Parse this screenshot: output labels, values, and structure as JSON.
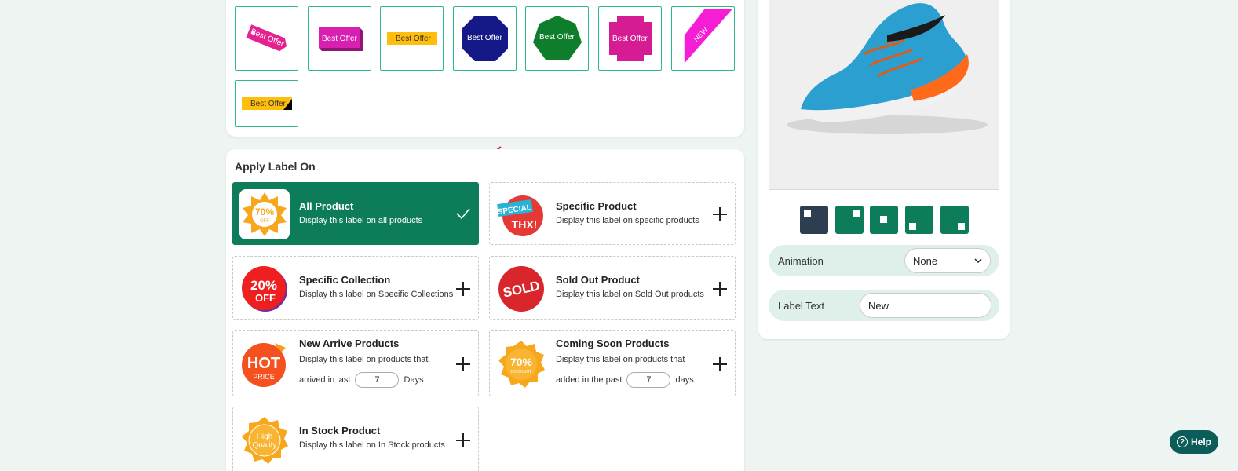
{
  "label_styles": [
    {
      "name": "tag",
      "text": "Best Offer"
    },
    {
      "name": "ribbon-3d",
      "text": "Best Offer"
    },
    {
      "name": "flat-yellow",
      "text": "Best Offer"
    },
    {
      "name": "octagon-navy",
      "text": "Best Offer"
    },
    {
      "name": "heptagon-green",
      "text": "Best Offer"
    },
    {
      "name": "cross-pink",
      "text": "Best Offer"
    },
    {
      "name": "corner-ribbon",
      "text": "NEW"
    },
    {
      "name": "yellow-black-corner",
      "text": "Best Offer"
    }
  ],
  "apply": {
    "section_title": "Apply Label On",
    "options": [
      {
        "id": "all",
        "title": "All Product",
        "desc": "Display this label on all products",
        "icon_text": "70%",
        "icon_sub": "OFF",
        "selected": true
      },
      {
        "id": "specific-product",
        "title": "Specific Product",
        "desc": "Display this label on specific products",
        "icon_text": "SPECIAL",
        "icon_sub": "THX!"
      },
      {
        "id": "specific-collection",
        "title": "Specific Collection",
        "desc": "Display this label on Specific Collections",
        "icon_text": "20%",
        "icon_sub": "OFF"
      },
      {
        "id": "sold-out",
        "title": "Sold Out Product",
        "desc": "Display this label on Sold Out products",
        "icon_text": "SOLD"
      },
      {
        "id": "new-arrive",
        "title": "New Arrive Products",
        "desc": "Display this label on products that",
        "desc2_pre": "arrived in last",
        "days_value": "7",
        "desc2_post": "Days",
        "icon_text": "HOT",
        "icon_sub": "PRICE"
      },
      {
        "id": "coming-soon",
        "title": "Coming Soon Products",
        "desc": "Display this label on products that",
        "desc2_pre": "added in the past",
        "days_value": "7",
        "desc2_post": "days",
        "icon_text": "70%",
        "icon_sub": "DISCOUNT"
      },
      {
        "id": "in-stock",
        "title": "In Stock Product",
        "desc": "Display this label on In Stock products",
        "icon_text": "High",
        "icon_sub": "Quality"
      }
    ]
  },
  "preview": {
    "animation_label": "Animation",
    "animation_value": "None",
    "label_text_label": "Label Text",
    "label_text_value": "New"
  },
  "help_label": "Help",
  "colors": {
    "accent": "#0d7c5b",
    "active_position": "#2c3e50",
    "tile_border": "#2db894"
  }
}
